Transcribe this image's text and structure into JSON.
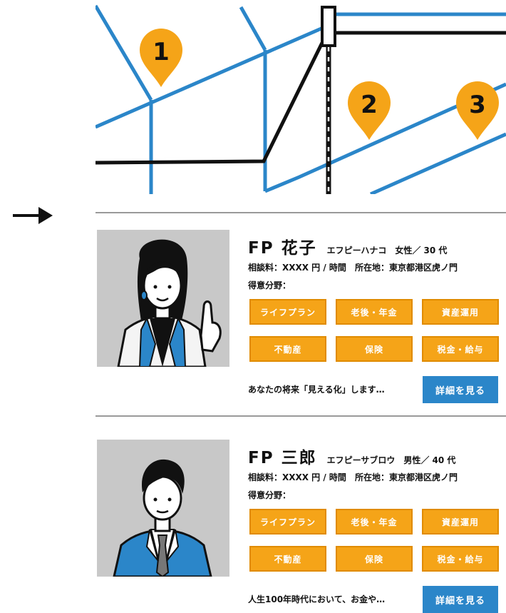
{
  "map": {
    "pins": [
      "1",
      "2",
      "3"
    ],
    "colors": {
      "road": "#2b86c9",
      "rail": "#111111",
      "pin": "#f5a418"
    }
  },
  "colors": {
    "tag_bg": "#f5a418",
    "button_bg": "#2b86c9",
    "divider": "#9a9a9a"
  },
  "advisors": [
    {
      "name": "FP 花子",
      "kana": "エフピーハナコ",
      "gender_age": "女性／ 30 代",
      "fee": "相談料：XXXX 円 / 時間",
      "location": "所在地：東京都港区虎ノ門",
      "specialty_label": "得意分野：",
      "tags": [
        "ライフプラン",
        "老後・年金",
        "資産運用",
        "不動産",
        "保険",
        "税金・給与"
      ],
      "description": "あなたの将来「見える化」します…",
      "detail_button": "詳細を見る"
    },
    {
      "name": "FP 三郎",
      "kana": "エフピーサブロウ",
      "gender_age": "男性／ 40 代",
      "fee": "相談料：XXXX 円 / 時間",
      "location": "所在地：東京都港区虎ノ門",
      "specialty_label": "得意分野：",
      "tags": [
        "ライフプラン",
        "老後・年金",
        "資産運用",
        "不動産",
        "保険",
        "税金・給与"
      ],
      "description": "人生100年時代において、お金や…",
      "detail_button": "詳細を見る"
    }
  ]
}
